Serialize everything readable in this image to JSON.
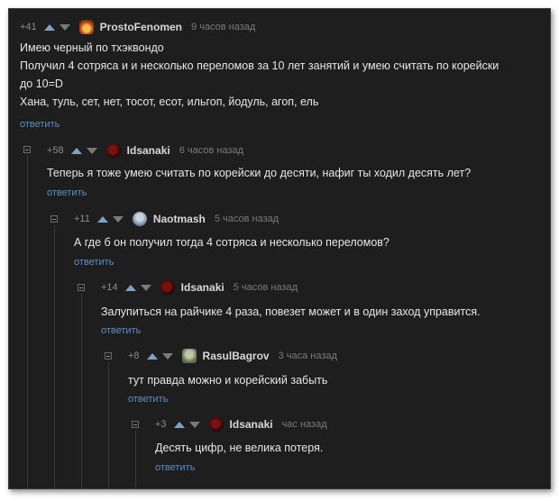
{
  "comments": [
    {
      "score": "+41",
      "author": "ProstoFenomen",
      "avatar_icon": "fire-avatar-icon",
      "time": "9 часов назад",
      "lines": [
        "Имею черный по тхэквондо",
        "Получил 4 сотряса и и несколько переломов за 10 лет занятий и умею считать по корейски",
        "до 10=D",
        "Хана, туль, сет, нет, тосот, есот, ильгоп, йодуль, агоп, ель"
      ],
      "reply": "ответить"
    },
    {
      "score": "+58",
      "author": "Idsanaki",
      "avatar_icon": "idsanaki-avatar-icon",
      "time": "6 часов назад",
      "lines": [
        "Теперь я тоже умею считать по корейски до десяти, нафиг ты ходил десять лет?"
      ],
      "reply": "ответить"
    },
    {
      "score": "+11",
      "author": "Naotmash",
      "avatar_icon": "naotmash-avatar-icon",
      "time": "5 часов назад",
      "lines": [
        "А где б он получил тогда 4 сотряса и несколько переломов?"
      ],
      "reply": "ответить"
    },
    {
      "score": "+14",
      "author": "Idsanaki",
      "avatar_icon": "idsanaki-avatar-icon",
      "time": "5 часов назад",
      "lines": [
        "Залупиться на райчике 4 раза, повезет может и в один заход управится."
      ],
      "reply": "ответить"
    },
    {
      "score": "+8",
      "author": "RasulBagrov",
      "avatar_icon": "rasulbagrov-avatar-icon",
      "time": "3 часа назад",
      "lines": [
        "тут правда можно и корейский забыть"
      ],
      "reply": "ответить"
    },
    {
      "score": "+3",
      "author": "Idsanaki",
      "avatar_icon": "idsanaki-avatar-icon",
      "time": "час назад",
      "lines": [
        "Десять цифр, не велика потеря."
      ],
      "reply": "ответить"
    }
  ]
}
